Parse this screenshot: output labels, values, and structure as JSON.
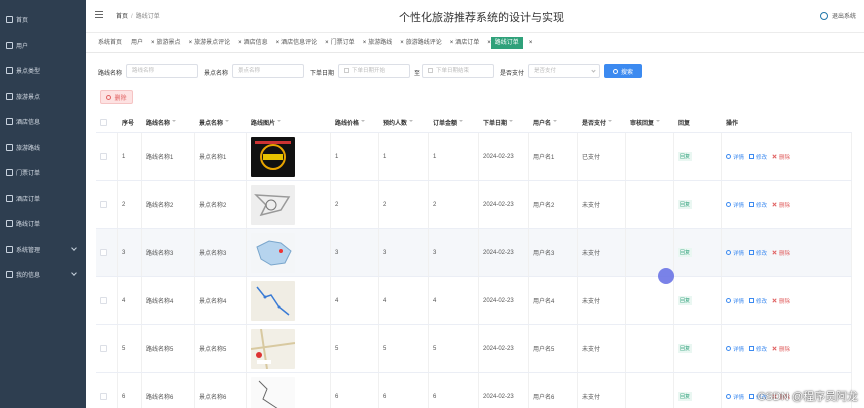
{
  "sidebar": {
    "items": [
      {
        "label": "首页",
        "icon": "home-icon"
      },
      {
        "label": "用户",
        "icon": "user-icon"
      },
      {
        "label": "景点类型",
        "icon": "grid-icon"
      },
      {
        "label": "旅游景点",
        "icon": "grid-icon"
      },
      {
        "label": "酒店信息",
        "icon": "grid-icon"
      },
      {
        "label": "旅游路线",
        "icon": "grid-icon"
      },
      {
        "label": "门票订单",
        "icon": "grid-icon"
      },
      {
        "label": "酒店订单",
        "icon": "grid-icon"
      },
      {
        "label": "路线订单",
        "icon": "grid-icon"
      },
      {
        "label": "系统管理",
        "icon": "grid-icon",
        "expandable": true
      },
      {
        "label": "我的信息",
        "icon": "grid-icon",
        "expandable": true
      }
    ]
  },
  "header": {
    "breadcrumb_home": "首页",
    "breadcrumb_sep": "/",
    "breadcrumb_current": "路线订单",
    "title": "个性化旅游推荐系统的设计与实现",
    "logout": "退出系统"
  },
  "tags": [
    "系统首页",
    "用户",
    "旅游景点",
    "旅游景点评论",
    "酒店信息",
    "酒店信息评论",
    "门票订单",
    "旅游路线",
    "旅游路线评论",
    "酒店订单",
    "路线订单"
  ],
  "search": {
    "route_label": "路线名称",
    "route_placeholder": "路线名称",
    "spot_label": "景点名称",
    "spot_placeholder": "景点名称",
    "date_label": "下单日期",
    "date_start_placeholder": "下单日期开始",
    "date_to": "至",
    "date_end_placeholder": "下单日期结束",
    "paid_label": "是否支付",
    "paid_placeholder": "是否支付",
    "search_button": "搜索"
  },
  "delete_button": "删除",
  "table": {
    "headers": [
      "序号",
      "路线名称",
      "景点名称",
      "路线图片",
      "路线价格",
      "预约人数",
      "订单金额",
      "下单日期",
      "用户名",
      "是否支付",
      "审核回复",
      "回复",
      "操作"
    ],
    "rows": [
      {
        "no": "1",
        "route": "路线名称1",
        "spot": "景点名称1",
        "price": "1",
        "people": "1",
        "amount": "1",
        "date": "2024-02-23",
        "user": "用户名1",
        "paid": "已支付",
        "review": "",
        "reply": "回复"
      },
      {
        "no": "2",
        "route": "路线名称2",
        "spot": "景点名称2",
        "price": "2",
        "people": "2",
        "amount": "2",
        "date": "2024-02-23",
        "user": "用户名2",
        "paid": "未支付",
        "review": "",
        "reply": "回复"
      },
      {
        "no": "3",
        "route": "路线名称3",
        "spot": "景点名称3",
        "price": "3",
        "people": "3",
        "amount": "3",
        "date": "2024-02-23",
        "user": "用户名3",
        "paid": "未支付",
        "review": "",
        "reply": "回复"
      },
      {
        "no": "4",
        "route": "路线名称4",
        "spot": "景点名称4",
        "price": "4",
        "people": "4",
        "amount": "4",
        "date": "2024-02-23",
        "user": "用户名4",
        "paid": "未支付",
        "review": "",
        "reply": "回复"
      },
      {
        "no": "5",
        "route": "路线名称5",
        "spot": "景点名称5",
        "price": "5",
        "people": "5",
        "amount": "5",
        "date": "2024-02-23",
        "user": "用户名5",
        "paid": "未支付",
        "review": "",
        "reply": "回复"
      },
      {
        "no": "6",
        "route": "路线名称6",
        "spot": "景点名称6",
        "price": "6",
        "people": "6",
        "amount": "6",
        "date": "2024-02-23",
        "user": "用户名6",
        "paid": "未支付",
        "review": "",
        "reply": "回复"
      }
    ],
    "ops": {
      "detail": "详情",
      "edit": "修改",
      "delete": "删除"
    }
  },
  "watermark": "CSDN @程序员阿龙",
  "colors": {
    "sidebar_bg": "#2e3e50",
    "accent": "#2fa17a",
    "primary": "#3c8af0",
    "danger": "#e06060"
  }
}
